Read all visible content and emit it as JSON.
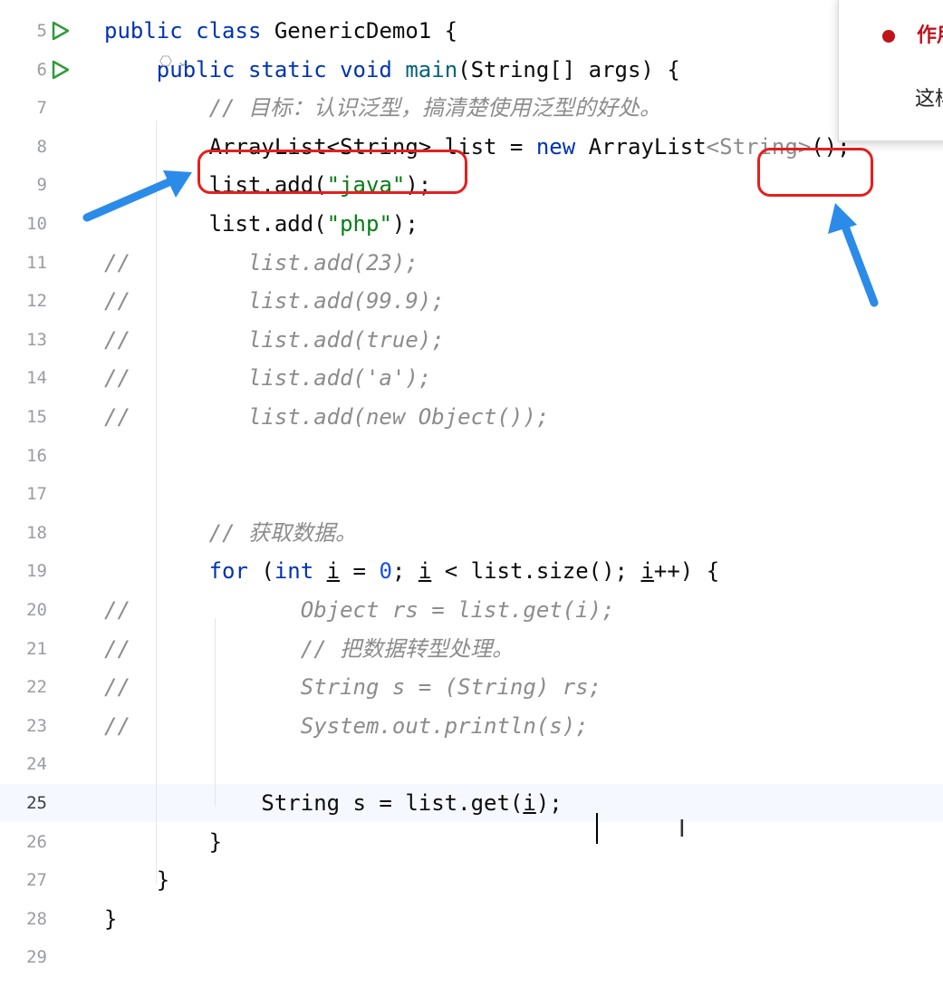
{
  "editor": {
    "hint": "⎔ ⌄",
    "lines": [
      {
        "n": "5",
        "parts": [
          {
            "c": "kw",
            "t": "public class "
          },
          {
            "t": "GenericDemo1 {"
          }
        ],
        "run": true
      },
      {
        "n": "6",
        "parts": [
          {
            "t": "    "
          },
          {
            "c": "kw",
            "t": "public static void "
          },
          {
            "c": "fn",
            "t": "main"
          },
          {
            "t": "(String[] args) {"
          }
        ],
        "run": true
      },
      {
        "n": "7",
        "parts": [
          {
            "t": "        "
          },
          {
            "c": "cmt",
            "t": "// "
          },
          {
            "c": "cmt cjk",
            "t": "目标：认识泛型，搞清楚使用泛型的好处。"
          }
        ]
      },
      {
        "n": "8",
        "parts": [
          {
            "t": "        ArrayList<String> list = "
          },
          {
            "c": "kw",
            "t": "new "
          },
          {
            "t": "ArrayList"
          },
          {
            "c": "gen",
            "t": "<String>"
          },
          {
            "t": "();"
          }
        ]
      },
      {
        "n": "9",
        "parts": [
          {
            "t": "        list.add("
          },
          {
            "c": "str",
            "t": "\"java\""
          },
          {
            "t": ");"
          }
        ]
      },
      {
        "n": "10",
        "parts": [
          {
            "t": "        list.add("
          },
          {
            "c": "str",
            "t": "\"php\""
          },
          {
            "t": ");"
          }
        ]
      },
      {
        "n": "11",
        "parts": [
          {
            "c": "cmt",
            "t": "//         list.add(23);"
          }
        ]
      },
      {
        "n": "12",
        "parts": [
          {
            "c": "cmt",
            "t": "//         list.add(99.9);"
          }
        ]
      },
      {
        "n": "13",
        "parts": [
          {
            "c": "cmt",
            "t": "//         list.add(true);"
          }
        ]
      },
      {
        "n": "14",
        "parts": [
          {
            "c": "cmt",
            "t": "//         list.add('a');"
          }
        ]
      },
      {
        "n": "15",
        "parts": [
          {
            "c": "cmt",
            "t": "//         list.add(new Object());"
          }
        ]
      },
      {
        "n": "16",
        "parts": []
      },
      {
        "n": "17",
        "parts": []
      },
      {
        "n": "18",
        "parts": [
          {
            "t": "        "
          },
          {
            "c": "cmt",
            "t": "// "
          },
          {
            "c": "cmt cjk",
            "t": "获取数据。"
          }
        ]
      },
      {
        "n": "19",
        "parts": [
          {
            "t": "        "
          },
          {
            "c": "kw",
            "t": "for "
          },
          {
            "t": "("
          },
          {
            "c": "kw",
            "t": "int "
          },
          {
            "c": "und",
            "t": "i"
          },
          {
            "t": " = "
          },
          {
            "c": "num",
            "t": "0"
          },
          {
            "t": "; "
          },
          {
            "c": "und",
            "t": "i"
          },
          {
            "t": " < list.size(); "
          },
          {
            "c": "und",
            "t": "i"
          },
          {
            "t": "++) {"
          }
        ]
      },
      {
        "n": "20",
        "parts": [
          {
            "c": "cmt",
            "t": "//             Object rs = list.get(i);"
          }
        ]
      },
      {
        "n": "21",
        "parts": [
          {
            "c": "cmt",
            "t": "//             // "
          },
          {
            "c": "cmt cjk",
            "t": "把数据转型处理。"
          }
        ]
      },
      {
        "n": "22",
        "parts": [
          {
            "c": "cmt",
            "t": "//             String s = (String) rs;"
          }
        ]
      },
      {
        "n": "23",
        "parts": [
          {
            "c": "cmt",
            "t": "//             System.out.println(s);"
          }
        ]
      },
      {
        "n": "24",
        "parts": []
      },
      {
        "n": "25",
        "parts": [
          {
            "t": "            String s = list.get("
          },
          {
            "c": "und",
            "t": "i"
          },
          {
            "t": ");"
          }
        ],
        "current": true
      },
      {
        "n": "26",
        "parts": [
          {
            "t": "        }"
          }
        ]
      },
      {
        "n": "27",
        "parts": [
          {
            "t": "    }"
          }
        ]
      },
      {
        "n": "28",
        "parts": [
          {
            "t": "}"
          }
        ]
      },
      {
        "n": "29",
        "parts": []
      }
    ]
  },
  "popup": {
    "line1": "作用",
    "line2": "这样"
  },
  "colors": {
    "annotation": "#e51f1f",
    "arrow": "#2b8be8"
  }
}
